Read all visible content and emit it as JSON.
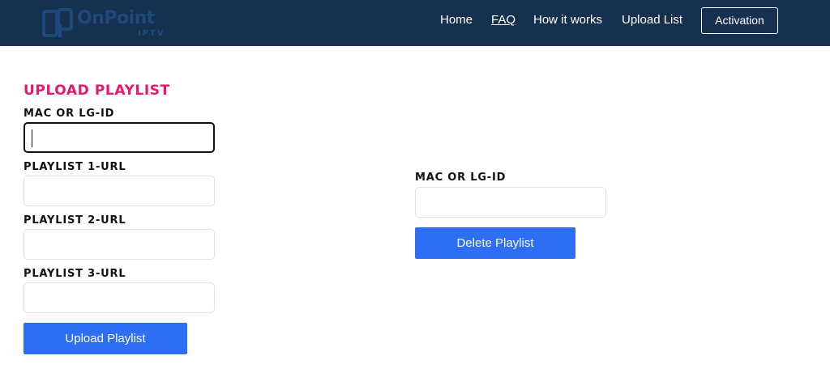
{
  "header": {
    "logo": {
      "name": "OnPoint",
      "sub": "IPTV"
    },
    "nav": {
      "home": "Home",
      "faq": "FAQ",
      "how_it_works": "How it works",
      "upload_list": "Upload List",
      "activation": "Activation"
    }
  },
  "upload": {
    "title": "UPLOAD PLAYLIST",
    "mac_label": "MAC OR LG-ID",
    "mac_value": "",
    "playlist1_label": "PLAYLIST 1-URL",
    "playlist1_value": "",
    "playlist2_label": "PLAYLIST 2-URL",
    "playlist2_value": "",
    "playlist3_label": "PLAYLIST 3-URL",
    "playlist3_value": "",
    "button": "Upload Playlist"
  },
  "delete": {
    "mac_label": "MAC OR LG-ID",
    "mac_value": "",
    "button": "Delete Playlist"
  },
  "colors": {
    "navbar": "#16304f",
    "title_accent": "#e5196e",
    "button": "#2d6ef5"
  }
}
